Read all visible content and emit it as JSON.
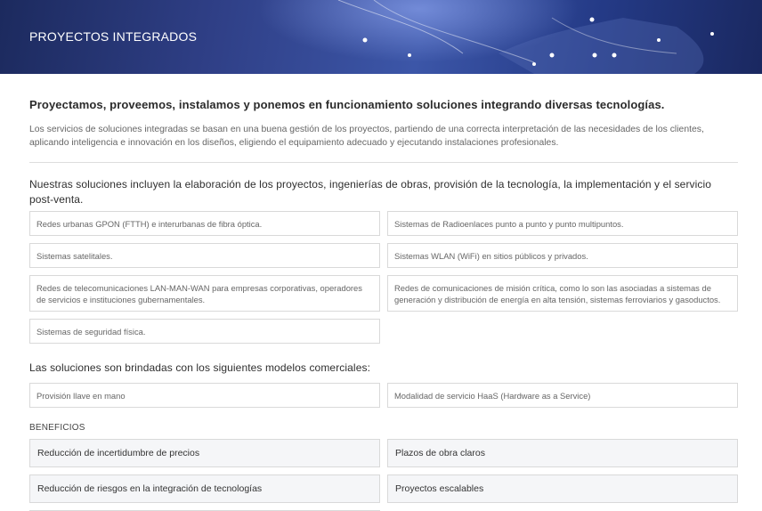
{
  "hero": {
    "title": "PROYECTOS INTEGRADOS"
  },
  "lead": "Proyectamos, proveemos, instalamos y ponemos en funcionamiento soluciones integrando diversas tecnologías.",
  "intro": "Los servicios de soluciones integradas se basan en una buena gestión de los proyectos, partiendo de una correcta interpretación de las necesidades de los clientes, aplicando inteligencia e innovación en los diseños, eligiendo el equipamiento adecuado y ejecutando instalaciones profesionales.",
  "solutions_intro": "Nuestras soluciones incluyen la elaboración de los proyectos, ingenierías de obras, provisión de la tecnología, la implementación y el servicio post-venta.",
  "solutions": [
    "Redes urbanas GPON (FTTH) e interurbanas de fibra óptica.",
    "Sistemas de Radioenlaces punto a punto y punto multipuntos.",
    "Sistemas satelitales.",
    "Sistemas WLAN (WiFi) en sitios públicos y privados.",
    "Redes de telecomunicaciones LAN-MAN-WAN para empresas corporativas, operadores de servicios e instituciones gubernamentales.",
    "Redes de comunicaciones de misión crítica, como lo son las asociadas a sistemas de generación y distribución de energía en alta tensión, sistemas ferroviarios y gasoductos.",
    "Sistemas de seguridad física."
  ],
  "models_title": "Las soluciones son brindadas con los siguientes modelos comerciales:",
  "models": [
    "Provisión llave en mano",
    "Modalidad de servicio HaaS (Hardware as a Service)"
  ],
  "benefits_title": "BENEFICIOS",
  "benefits": [
    "Reducción de incertidumbre de precios",
    "Plazos de obra claros",
    "Reducción de riesgos en la integración de tecnologías",
    "Proyectos escalables"
  ]
}
